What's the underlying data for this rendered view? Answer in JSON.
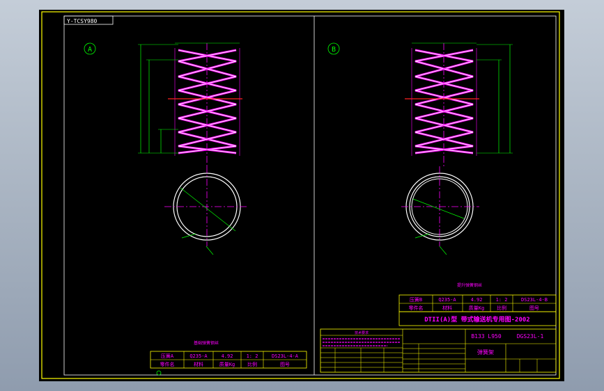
{
  "colors": {
    "frame": "#ffff00",
    "dimension": "#00ff00",
    "spring": "#ff00ff",
    "outline": "#ffffff",
    "table": "#ffff00",
    "centerline": "#ff0000",
    "table_text": "#ff00ff"
  },
  "drawing": {
    "corner_tag": "Y-TCSY980",
    "view_a_label": "A",
    "view_b_label": "B",
    "left_caption": "基础弹簧钢丝",
    "right_caption": "提升弹簧钢丝",
    "left_table": {
      "row1": [
        "压簧A",
        "Q235-A",
        "4.92",
        "1: 2",
        "DS23L-4-A"
      ],
      "row2": [
        "零件名",
        "材料",
        "质量Kg",
        "比例",
        "图号"
      ]
    },
    "right_table": {
      "row1": [
        "压簧B",
        "Q235-A",
        "4.92",
        "1: 2",
        "DS23L-4-B"
      ],
      "row2": [
        "零件名",
        "材料",
        "质量Kg",
        "比例",
        "图号"
      ]
    },
    "title_block": {
      "series": "DTII(A)型 带式输送机专用图-2002",
      "spec": "B133 L950",
      "drawing_no": "DGS23L-1",
      "part_name": "弹簧架",
      "notes_title": "技术要求"
    }
  }
}
